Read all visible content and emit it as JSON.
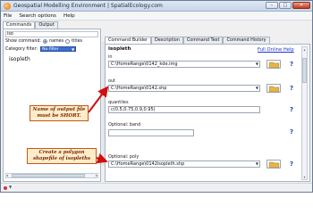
{
  "window": {
    "title": "Geospatial Modelling Environment | SpatialEcology.com",
    "buttons": {
      "minimize": "–",
      "maximize": "□",
      "close": "✕"
    }
  },
  "menu": [
    "File",
    "Search options",
    "Help"
  ],
  "left_panel": {
    "tabs": [
      "Commands",
      "Output"
    ],
    "search_value": "iso",
    "show_command_label": "Show command:",
    "show_options": [
      "names",
      "titles"
    ],
    "show_selected": "names",
    "category_label": "Category filter:",
    "category_value": "No filter",
    "list_items": [
      "isopleth"
    ]
  },
  "right_panel": {
    "tabs": [
      "Command Builder",
      "Description",
      "Command Text",
      "Command History"
    ],
    "command_name": "isopleth",
    "help_link": "Full Online Help",
    "params": [
      {
        "label": "in",
        "value": "C:\\HomeRange\\0142_kde.img",
        "kind": "combo",
        "folder": true
      },
      {
        "label": "out",
        "value": "C:\\HomeRange\\0142.shp",
        "kind": "combo",
        "folder": true
      },
      {
        "label": "quantiles",
        "value": "c(0.5,0.75,0.9,0.95)",
        "kind": "text",
        "folder": false
      },
      {
        "label": "Optional: band",
        "value": "",
        "kind": "empty",
        "folder": false
      },
      {
        "label": "Optional: poly",
        "value": "C:\\HomeRange\\0142isopleth.shp",
        "kind": "combo",
        "folder": true
      }
    ],
    "help_mark": "?"
  },
  "annotations": [
    "Name of output file must be SHORT.",
    "Create a polygon shapefile of isopleths"
  ],
  "colors": {
    "annotation_border": "#c45a10",
    "annotation_text": "#7a2b00",
    "arrow": "#d01010",
    "link": "#1a36c9",
    "help_mark": "#1f3fb0"
  }
}
